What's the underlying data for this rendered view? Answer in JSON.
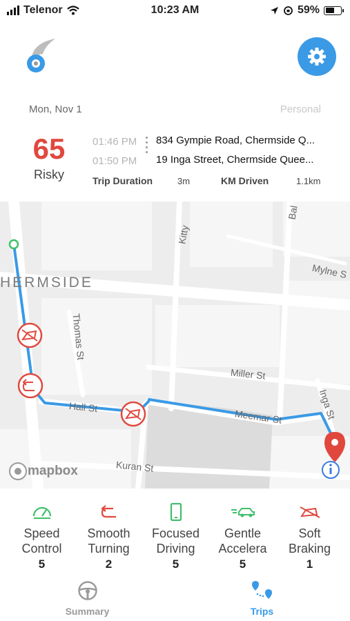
{
  "status_bar": {
    "carrier": "Telenor",
    "time": "10:23 AM",
    "battery": "59%"
  },
  "header": {
    "settings_icon": "gear-icon"
  },
  "trip": {
    "date": "Mon, Nov 1",
    "category": "Personal",
    "score": "65",
    "score_label": "Risky",
    "start_time": "01:46 PM",
    "end_time": "01:50 PM",
    "start_address": "834 Gympie Road, Chermside Q...",
    "end_address": "19 Inga Street, Chermside Quee...",
    "duration_label": "Trip Duration",
    "duration_value": "3m",
    "distance_label": "KM Driven",
    "distance_value": "1.1km"
  },
  "map": {
    "attribution": "mapbox",
    "suburb": "HERMSIDE",
    "streets": [
      "Kitty",
      "Bal",
      "Mylne S",
      "Thomas St",
      "Miller St",
      "Hall St",
      "Meemar St",
      "Inga St",
      "Kuran St"
    ],
    "route_color": "#3a9ae6",
    "event_color": "#e0483e"
  },
  "behaviours": [
    {
      "name_line1": "Speed",
      "name_line2": "Control",
      "value": "5",
      "icon": "speedometer-icon",
      "color": "#3fbf6a"
    },
    {
      "name_line1": "Smooth",
      "name_line2": "Turning",
      "value": "2",
      "icon": "u-turn-icon",
      "color": "#e0483e"
    },
    {
      "name_line1": "Focused",
      "name_line2": "Driving",
      "value": "5",
      "icon": "phone-icon",
      "color": "#3fbf6a"
    },
    {
      "name_line1": "Gentle",
      "name_line2": "Accelera",
      "value": "5",
      "icon": "fast-car-icon",
      "color": "#3fbf6a"
    },
    {
      "name_line1": "Soft",
      "name_line2": "Braking",
      "value": "1",
      "icon": "brake-car-icon",
      "color": "#e0483e"
    }
  ],
  "tabs": [
    {
      "label": "Summary",
      "icon": "steering-wheel-icon",
      "active": false
    },
    {
      "label": "Trips",
      "icon": "route-pins-icon",
      "active": true
    }
  ]
}
